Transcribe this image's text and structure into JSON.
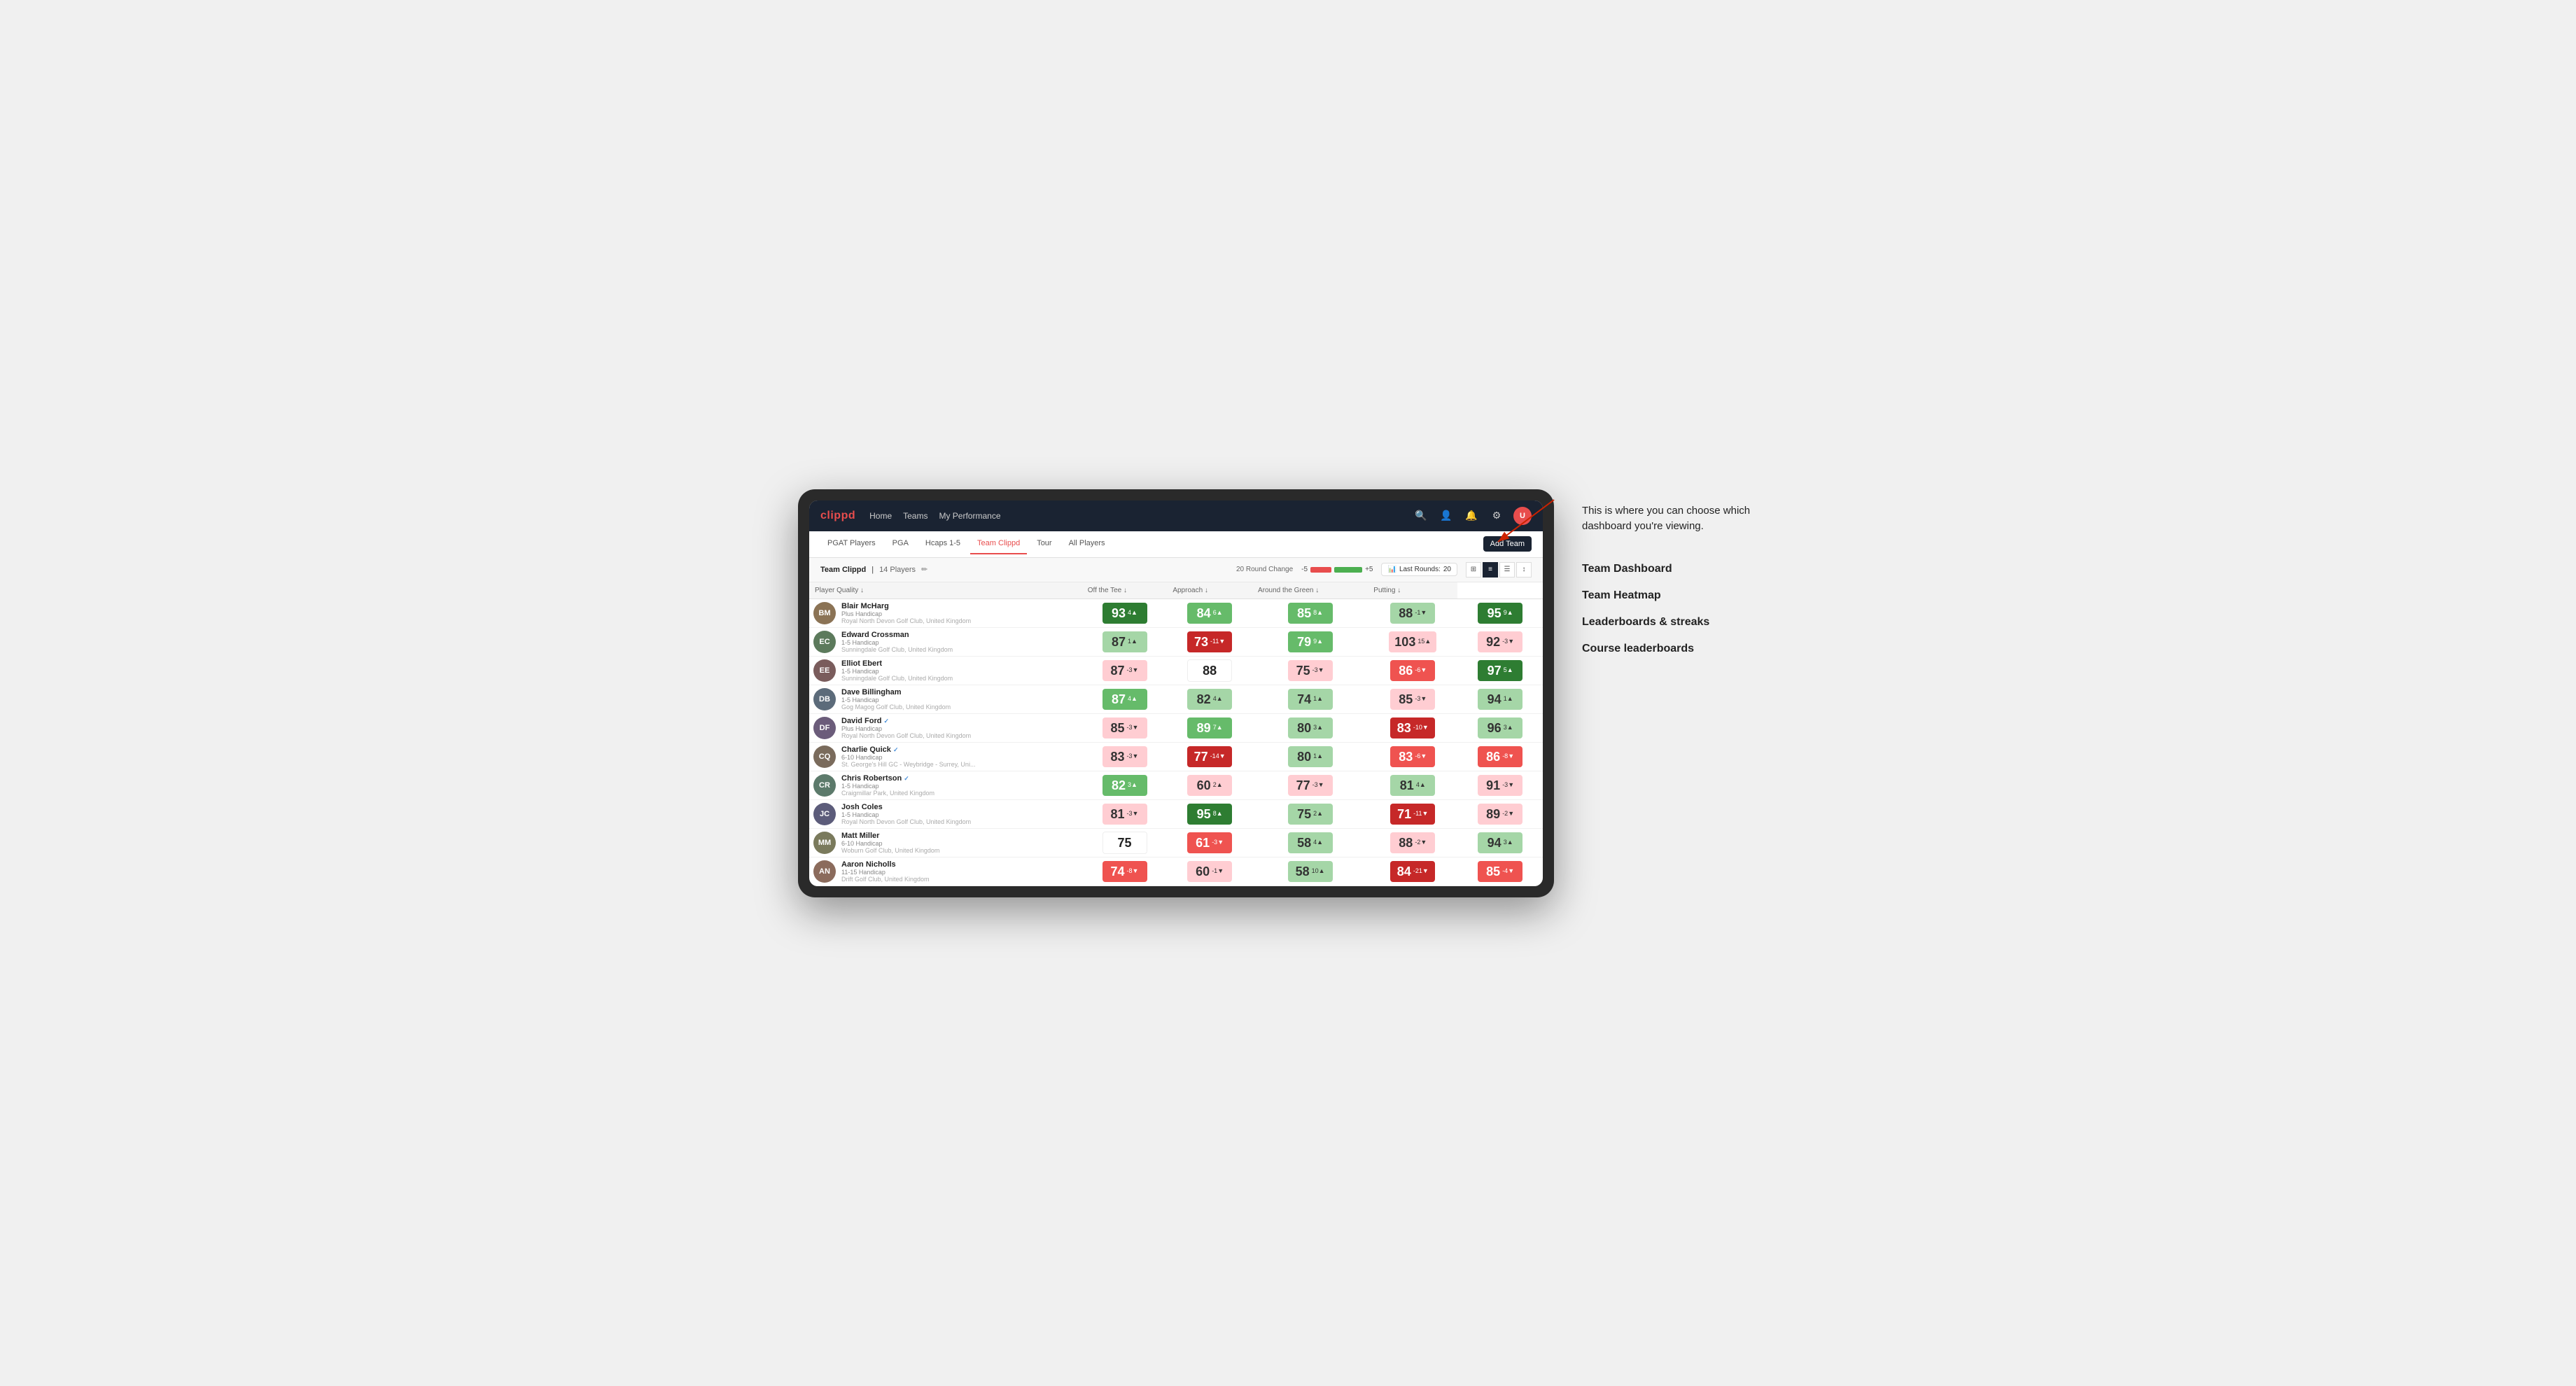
{
  "annotation": {
    "description": "This is where you can choose which dashboard you're viewing.",
    "menu_items": [
      "Team Dashboard",
      "Team Heatmap",
      "Leaderboards & streaks",
      "Course leaderboards"
    ]
  },
  "nav": {
    "logo": "clippd",
    "items": [
      "Home",
      "Teams",
      "My Performance"
    ],
    "icons": [
      "search",
      "person",
      "bell",
      "settings",
      "avatar"
    ]
  },
  "sub_nav": {
    "items": [
      "PGAT Players",
      "PGA",
      "Hcaps 1-5",
      "Team Clippd",
      "Tour",
      "All Players"
    ],
    "active": "Team Clippd",
    "add_team_label": "Add Team"
  },
  "team_bar": {
    "title": "Team Clippd",
    "separator": "|",
    "count": "14 Players",
    "round_change_label": "20 Round Change",
    "neg_label": "-5",
    "pos_label": "+5",
    "last_rounds_label": "Last Rounds:",
    "last_rounds_value": "20"
  },
  "table": {
    "columns": [
      {
        "key": "player",
        "label": "Player Quality ↓"
      },
      {
        "key": "off_tee",
        "label": "Off the Tee ↓"
      },
      {
        "key": "approach",
        "label": "Approach ↓"
      },
      {
        "key": "around_green",
        "label": "Around the Green ↓"
      },
      {
        "key": "putting",
        "label": "Putting ↓"
      }
    ],
    "players": [
      {
        "name": "Blair McHarg",
        "handicap": "Plus Handicap",
        "club": "Royal North Devon Golf Club, United Kingdom",
        "verified": false,
        "initials": "BM",
        "color": "#8b7355",
        "scores": {
          "player_quality": {
            "value": 93,
            "change": "4▲",
            "color": "green-dark"
          },
          "off_tee": {
            "value": 84,
            "change": "6▲",
            "color": "green-mid"
          },
          "approach": {
            "value": 85,
            "change": "8▲",
            "color": "green-mid"
          },
          "around_green": {
            "value": 88,
            "change": "-1▼",
            "color": "green-light"
          },
          "putting": {
            "value": 95,
            "change": "9▲",
            "color": "green-dark"
          }
        }
      },
      {
        "name": "Edward Crossman",
        "handicap": "1-5 Handicap",
        "club": "Sunningdale Golf Club, United Kingdom",
        "verified": false,
        "initials": "EC",
        "color": "#5c7a5c",
        "scores": {
          "player_quality": {
            "value": 87,
            "change": "1▲",
            "color": "green-light"
          },
          "off_tee": {
            "value": 73,
            "change": "-11▼",
            "color": "red-dark"
          },
          "approach": {
            "value": 79,
            "change": "9▲",
            "color": "green-mid"
          },
          "around_green": {
            "value": 103,
            "change": "15▲",
            "color": "red-light"
          },
          "putting": {
            "value": 92,
            "change": "-3▼",
            "color": "red-light"
          }
        }
      },
      {
        "name": "Elliot Ebert",
        "handicap": "1-5 Handicap",
        "club": "Sunningdale Golf Club, United Kingdom",
        "verified": false,
        "initials": "EE",
        "color": "#7a5c5c",
        "scores": {
          "player_quality": {
            "value": 87,
            "change": "-3▼",
            "color": "red-light"
          },
          "off_tee": {
            "value": 88,
            "change": "",
            "color": "neutral"
          },
          "approach": {
            "value": 75,
            "change": "-3▼",
            "color": "red-light"
          },
          "around_green": {
            "value": 86,
            "change": "-6▼",
            "color": "red-mid"
          },
          "putting": {
            "value": 97,
            "change": "5▲",
            "color": "green-dark"
          }
        }
      },
      {
        "name": "Dave Billingham",
        "handicap": "1-5 Handicap",
        "club": "Gog Magog Golf Club, United Kingdom",
        "verified": false,
        "initials": "DB",
        "color": "#5c6b7a",
        "scores": {
          "player_quality": {
            "value": 87,
            "change": "4▲",
            "color": "green-mid"
          },
          "off_tee": {
            "value": 82,
            "change": "4▲",
            "color": "green-light"
          },
          "approach": {
            "value": 74,
            "change": "1▲",
            "color": "green-light"
          },
          "around_green": {
            "value": 85,
            "change": "-3▼",
            "color": "red-light"
          },
          "putting": {
            "value": 94,
            "change": "1▲",
            "color": "green-light"
          }
        }
      },
      {
        "name": "David Ford",
        "handicap": "Plus Handicap",
        "club": "Royal North Devon Golf Club, United Kingdom",
        "verified": true,
        "initials": "DF",
        "color": "#6b5c7a",
        "scores": {
          "player_quality": {
            "value": 85,
            "change": "-3▼",
            "color": "red-light"
          },
          "off_tee": {
            "value": 89,
            "change": "7▲",
            "color": "green-mid"
          },
          "approach": {
            "value": 80,
            "change": "3▲",
            "color": "green-light"
          },
          "around_green": {
            "value": 83,
            "change": "-10▼",
            "color": "red-dark"
          },
          "putting": {
            "value": 96,
            "change": "3▲",
            "color": "green-light"
          }
        }
      },
      {
        "name": "Charlie Quick",
        "handicap": "6-10 Handicap",
        "club": "St. George's Hill GC - Weybridge - Surrey, Uni...",
        "verified": true,
        "initials": "CQ",
        "color": "#7a6b5c",
        "scores": {
          "player_quality": {
            "value": 83,
            "change": "-3▼",
            "color": "red-light"
          },
          "off_tee": {
            "value": 77,
            "change": "-14▼",
            "color": "red-dark"
          },
          "approach": {
            "value": 80,
            "change": "1▲",
            "color": "green-light"
          },
          "around_green": {
            "value": 83,
            "change": "-6▼",
            "color": "red-mid"
          },
          "putting": {
            "value": 86,
            "change": "-8▼",
            "color": "red-mid"
          }
        }
      },
      {
        "name": "Chris Robertson",
        "handicap": "1-5 Handicap",
        "club": "Craigmillar Park, United Kingdom",
        "verified": true,
        "initials": "CR",
        "color": "#5c7a6b",
        "scores": {
          "player_quality": {
            "value": 82,
            "change": "3▲",
            "color": "green-mid"
          },
          "off_tee": {
            "value": 60,
            "change": "2▲",
            "color": "red-light"
          },
          "approach": {
            "value": 77,
            "change": "-3▼",
            "color": "red-light"
          },
          "around_green": {
            "value": 81,
            "change": "4▲",
            "color": "green-light"
          },
          "putting": {
            "value": 91,
            "change": "-3▼",
            "color": "red-light"
          }
        }
      },
      {
        "name": "Josh Coles",
        "handicap": "1-5 Handicap",
        "club": "Royal North Devon Golf Club, United Kingdom",
        "verified": false,
        "initials": "JC",
        "color": "#5c5c7a",
        "scores": {
          "player_quality": {
            "value": 81,
            "change": "-3▼",
            "color": "red-light"
          },
          "off_tee": {
            "value": 95,
            "change": "8▲",
            "color": "green-dark"
          },
          "approach": {
            "value": 75,
            "change": "2▲",
            "color": "green-light"
          },
          "around_green": {
            "value": 71,
            "change": "-11▼",
            "color": "red-dark"
          },
          "putting": {
            "value": 89,
            "change": "-2▼",
            "color": "red-light"
          }
        }
      },
      {
        "name": "Matt Miller",
        "handicap": "6-10 Handicap",
        "club": "Woburn Golf Club, United Kingdom",
        "verified": false,
        "initials": "MM",
        "color": "#7a7a5c",
        "scores": {
          "player_quality": {
            "value": 75,
            "change": "",
            "color": "neutral"
          },
          "off_tee": {
            "value": 61,
            "change": "-3▼",
            "color": "red-mid"
          },
          "approach": {
            "value": 58,
            "change": "4▲",
            "color": "green-light"
          },
          "around_green": {
            "value": 88,
            "change": "-2▼",
            "color": "red-light"
          },
          "putting": {
            "value": 94,
            "change": "3▲",
            "color": "green-light"
          }
        }
      },
      {
        "name": "Aaron Nicholls",
        "handicap": "11-15 Handicap",
        "club": "Drift Golf Club, United Kingdom",
        "verified": false,
        "initials": "AN",
        "color": "#8b6b5c",
        "scores": {
          "player_quality": {
            "value": 74,
            "change": "-8▼",
            "color": "red-mid"
          },
          "off_tee": {
            "value": 60,
            "change": "-1▼",
            "color": "red-light"
          },
          "approach": {
            "value": 58,
            "change": "10▲",
            "color": "green-light"
          },
          "around_green": {
            "value": 84,
            "change": "-21▼",
            "color": "red-dark"
          },
          "putting": {
            "value": 85,
            "change": "-4▼",
            "color": "red-mid"
          }
        }
      }
    ]
  }
}
